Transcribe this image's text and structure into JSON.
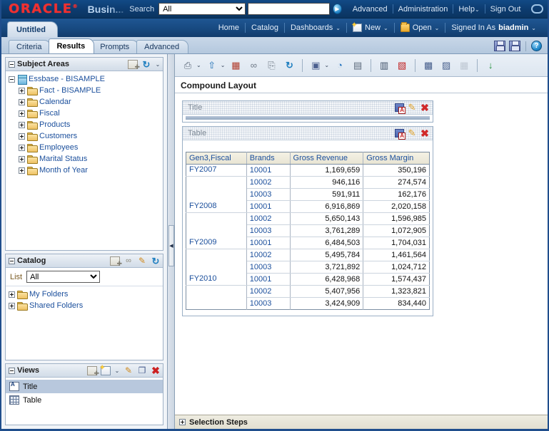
{
  "global_header": {
    "logo_text": "ORACLE",
    "logo_tm": "®",
    "logo_color": "#f03030",
    "product_name": "Busin...",
    "search_label": "Search",
    "search_scope_value": "All",
    "search_scope_options": [
      "All"
    ],
    "search_input_value": "",
    "search_input_placeholder": "",
    "go_icon": "play-icon",
    "links": [
      {
        "label": "Advanced",
        "name": "advanced-link"
      },
      {
        "label": "Administration",
        "name": "administration-link"
      },
      {
        "label": "Help",
        "name": "help-link",
        "caret": "⌄"
      },
      {
        "label": "Sign Out",
        "name": "sign-out-link"
      }
    ]
  },
  "appbar": {
    "document_tab": "Untitled",
    "items": [
      {
        "label": "Home",
        "name": "home-link"
      },
      {
        "label": "Catalog",
        "name": "catalog-link"
      },
      {
        "label": "Dashboards",
        "name": "dashboards-menu",
        "caret": "⌄"
      },
      {
        "label": "New",
        "name": "new-menu",
        "icon": "new-page-icon",
        "caret": "⌄"
      },
      {
        "label": "Open",
        "name": "open-menu",
        "icon": "folder-open-icon",
        "caret": "⌄"
      }
    ],
    "signed_in_as_label": "Signed In As",
    "signed_in_user": "biadmin",
    "signed_in_caret": "⌄"
  },
  "editor_tabs": {
    "tabs": [
      {
        "label": "Criteria",
        "active": false
      },
      {
        "label": "Results",
        "active": true
      },
      {
        "label": "Prompts",
        "active": false
      },
      {
        "label": "Advanced",
        "active": false
      }
    ],
    "right_buttons": [
      {
        "name": "save-button",
        "icon": "save-icon"
      },
      {
        "name": "save-as-button",
        "icon": "save-as-icon"
      },
      {
        "name": "help-button",
        "icon": "help-icon",
        "glyph": "?"
      }
    ]
  },
  "subject_areas": {
    "title": "Subject Areas",
    "header_icons": [
      {
        "name": "add-subject-area-icon",
        "glyph": ""
      },
      {
        "name": "refresh-icon",
        "glyph": "↻"
      },
      {
        "name": "chevron-down-icon",
        "glyph": "⌄"
      }
    ],
    "root": {
      "label": "Essbase - BISAMPLE",
      "icon": "cube-icon",
      "expanded": true
    },
    "folders": [
      "Fact - BISAMPLE",
      "Calendar",
      "Fiscal",
      "Products",
      "Customers",
      "Employees",
      "Marital Status",
      "Month of Year"
    ]
  },
  "catalog": {
    "title": "Catalog",
    "header_icons": [
      {
        "name": "add-catalog-item-icon",
        "glyph": ""
      },
      {
        "name": "binoculars-icon",
        "glyph": "∞"
      },
      {
        "name": "edit-pencil-icon",
        "glyph": "✎"
      },
      {
        "name": "refresh-icon",
        "glyph": "↻"
      }
    ],
    "list_label": "List",
    "list_value": "All",
    "list_options": [
      "All"
    ],
    "folders": [
      "My Folders",
      "Shared Folders"
    ]
  },
  "views": {
    "title": "Views",
    "header_icons": [
      {
        "name": "add-view-icon",
        "glyph": ""
      },
      {
        "name": "new-view-icon",
        "glyph": ""
      },
      {
        "name": "chevron-down-icon",
        "glyph": "⌄"
      },
      {
        "name": "edit-view-icon",
        "glyph": "✎"
      },
      {
        "name": "duplicate-view-icon",
        "glyph": "❐"
      },
      {
        "name": "remove-view-icon",
        "glyph": "✖"
      }
    ],
    "items": [
      {
        "label": "Title",
        "icon": "title-view-icon",
        "selected": true
      },
      {
        "label": "Table",
        "icon": "table-view-icon",
        "selected": false
      }
    ]
  },
  "results_toolbar": {
    "buttons": [
      {
        "name": "print-button",
        "icon": "printer-icon",
        "glyph": "⎙",
        "caret": "⌄"
      },
      {
        "name": "export-button",
        "icon": "export-icon",
        "glyph": "⇧",
        "caret": "⌄"
      },
      {
        "name": "schedule-button",
        "icon": "schedule-icon",
        "glyph": "▦"
      },
      {
        "name": "preview-button",
        "icon": "binoculars-icon",
        "glyph": "∞"
      },
      {
        "name": "copy-button",
        "icon": "copy-icon",
        "glyph": "⎘"
      },
      {
        "name": "refresh-button",
        "icon": "refresh-icon",
        "glyph": "↻"
      },
      {
        "name": "new-view-button",
        "icon": "new-view-icon",
        "glyph": "▣",
        "caret": "⌄"
      },
      {
        "name": "new-chart-button",
        "icon": "chart-icon",
        "glyph": "◔"
      },
      {
        "name": "new-gauge-button",
        "icon": "gauge-icon",
        "glyph": "▤"
      },
      {
        "name": "edit-formula-button",
        "icon": "xyz-icon",
        "glyph": "▥"
      },
      {
        "name": "edit-markup-button",
        "icon": "markup-icon",
        "glyph": "▧"
      },
      {
        "name": "layout-properties-button",
        "icon": "layout-new-icon",
        "glyph": "▩"
      },
      {
        "name": "compound-layout-button",
        "icon": "compound-layout-icon",
        "glyph": "▨"
      },
      {
        "name": "remove-layout-button",
        "icon": "remove-layout-icon",
        "glyph": "▦",
        "disabled": true
      },
      {
        "name": "sort-button",
        "icon": "sort-descending-icon",
        "glyph": "↓"
      }
    ]
  },
  "compound_layout": {
    "header": "Compound Layout",
    "views": [
      {
        "name": "title-view",
        "label": "Title",
        "icons": [
          {
            "name": "format-view-icon"
          },
          {
            "name": "edit-view-icon",
            "glyph": "✎"
          },
          {
            "name": "remove-view-icon",
            "glyph": "✖"
          }
        ]
      },
      {
        "name": "table-view",
        "label": "Table",
        "icons": [
          {
            "name": "format-view-icon"
          },
          {
            "name": "edit-view-icon",
            "glyph": "✎"
          },
          {
            "name": "remove-view-icon",
            "glyph": "✖"
          }
        ]
      }
    ]
  },
  "chart_data": {
    "type": "table",
    "title": "",
    "columns": [
      "Gen3,Fiscal",
      "Brands",
      "Gross Revenue",
      "Gross Margin"
    ],
    "rows": [
      {
        "fiscal": "FY2007",
        "brand": "10001",
        "gross_revenue": "1,169,659",
        "gross_margin": "350,196",
        "group_start": true
      },
      {
        "fiscal": "",
        "brand": "10002",
        "gross_revenue": "946,116",
        "gross_margin": "274,574",
        "group_start": false
      },
      {
        "fiscal": "",
        "brand": "10003",
        "gross_revenue": "591,911",
        "gross_margin": "162,176",
        "group_start": false
      },
      {
        "fiscal": "FY2008",
        "brand": "10001",
        "gross_revenue": "6,916,869",
        "gross_margin": "2,020,158",
        "group_start": true
      },
      {
        "fiscal": "",
        "brand": "10002",
        "gross_revenue": "5,650,143",
        "gross_margin": "1,596,985",
        "group_start": false
      },
      {
        "fiscal": "",
        "brand": "10003",
        "gross_revenue": "3,761,289",
        "gross_margin": "1,072,905",
        "group_start": false
      },
      {
        "fiscal": "FY2009",
        "brand": "10001",
        "gross_revenue": "6,484,503",
        "gross_margin": "1,704,031",
        "group_start": true
      },
      {
        "fiscal": "",
        "brand": "10002",
        "gross_revenue": "5,495,784",
        "gross_margin": "1,461,564",
        "group_start": false
      },
      {
        "fiscal": "",
        "brand": "10003",
        "gross_revenue": "3,721,892",
        "gross_margin": "1,024,712",
        "group_start": false
      },
      {
        "fiscal": "FY2010",
        "brand": "10001",
        "gross_revenue": "6,428,968",
        "gross_margin": "1,574,437",
        "group_start": true
      },
      {
        "fiscal": "",
        "brand": "10002",
        "gross_revenue": "5,407,956",
        "gross_margin": "1,323,821",
        "group_start": false
      },
      {
        "fiscal": "",
        "brand": "10003",
        "gross_revenue": "3,424,909",
        "gross_margin": "834,440",
        "group_start": false
      }
    ]
  },
  "selection_steps": {
    "label": "Selection Steps",
    "expanded": false
  },
  "colors": {
    "header_blue": "#0d3c70",
    "accent_blue": "#1b4f9c",
    "oracle_red": "#f03030",
    "panel_bg": "#f1f4f8",
    "table_header_bg": "#e8e4d3"
  }
}
